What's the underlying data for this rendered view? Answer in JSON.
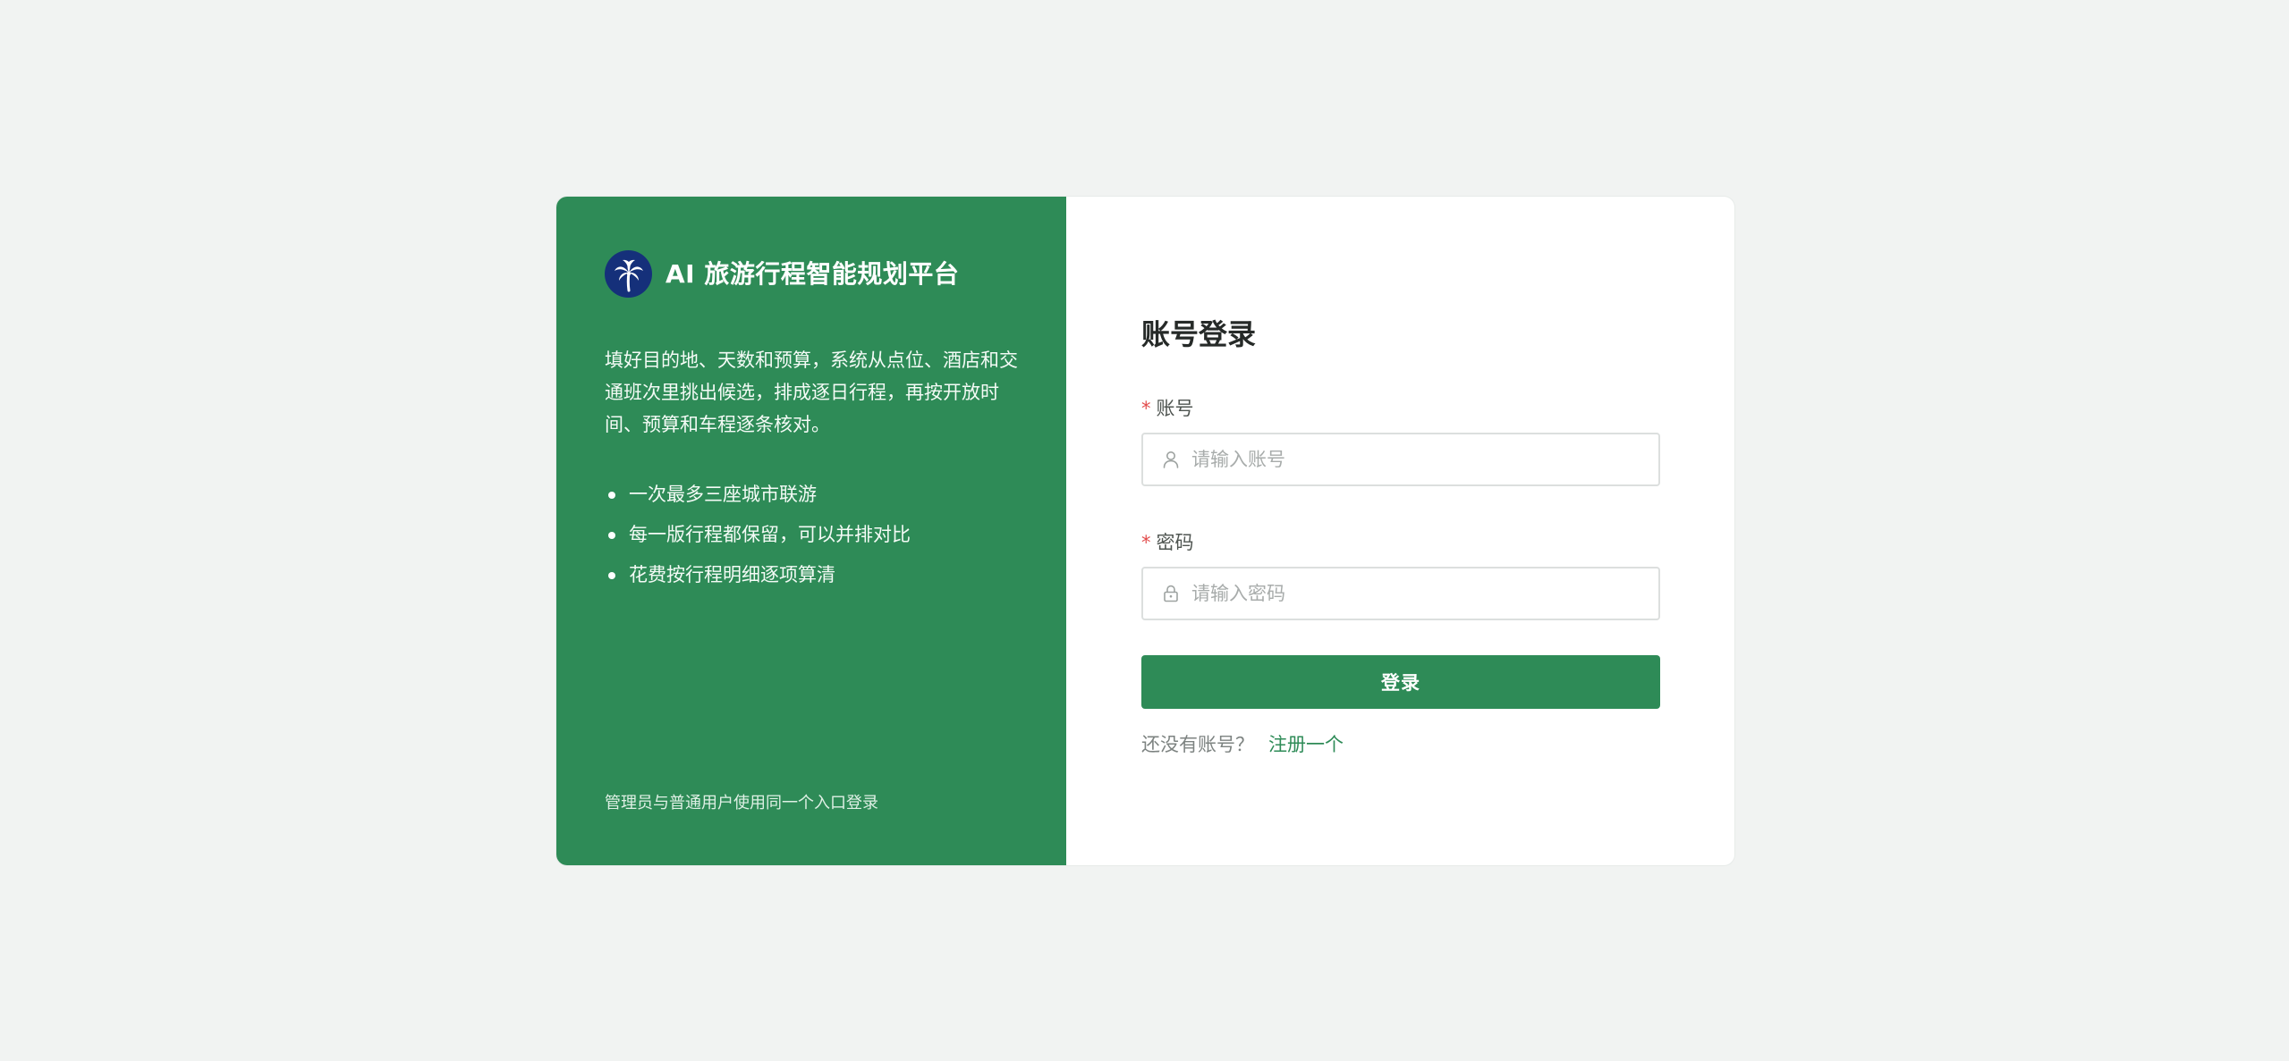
{
  "brand": {
    "title": "AI 旅游行程智能规划平台",
    "logo_icon": "palm-tree-icon"
  },
  "intro": "填好目的地、天数和预算，系统从点位、酒店和交通班次里挑出候选，排成逐日行程，再按开放时间、预算和车程逐条核对。",
  "features": [
    "一次最多三座城市联游",
    "每一版行程都保留，可以并排对比",
    "花费按行程明细逐项算清"
  ],
  "left_footer": "管理员与普通用户使用同一个入口登录",
  "login": {
    "title": "账号登录",
    "required_mark": "*",
    "account": {
      "label": "账号",
      "placeholder": "请输入账号",
      "value": "",
      "icon": "user-icon"
    },
    "password": {
      "label": "密码",
      "placeholder": "请输入密码",
      "value": "",
      "icon": "lock-icon"
    },
    "submit_label": "登录",
    "register_prompt": "还没有账号？",
    "register_link": "注册一个"
  },
  "colors": {
    "primary": "#2e8b57",
    "page_background": "#f1f3f2",
    "logo_background": "#15307a",
    "required": "#e24b4b"
  }
}
